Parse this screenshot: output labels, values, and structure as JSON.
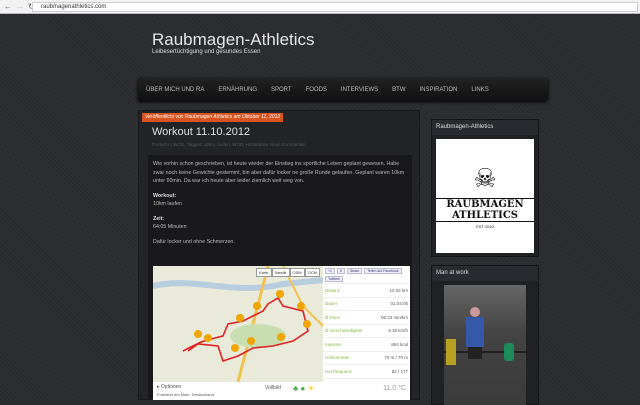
{
  "browser": {
    "url": "raubmagenathletics.com"
  },
  "site": {
    "title": "Raubmagen-Athletics",
    "tagline": "Leibesertüchtigung und gesundes Essen"
  },
  "nav": [
    "ÜBER MICH UND RA",
    "ERNÄHRUNG",
    "SPORT",
    "FOODS",
    "INTERVIEWS",
    "BTW",
    "INSPIRATION",
    "LINKS"
  ],
  "post": {
    "ribbon": "Veröffentlicht von Raubmagen Athletics am Oktober 11, 2012",
    "title": "Workout 11.10.2012",
    "meta": "Posted in: WOD. Tagged: 10km, laufen, WOD. Hinterlasse einen Kommentar",
    "intro": "Wie vorhin schon geschrieben, ist heute wieder der Einstieg ins sportliche Leben geplant gewesen. Habe zwar noch keine Gewichte gestemmt, bin aber dafür locker ne große Runde gelaufen. Geplant waren 10km unter 60min. Da war ich heute aber leider ziemlich weit weg von.",
    "workout_label": "Workout:",
    "workout": "10km laufen",
    "time_label": "Zeit:",
    "time": "64:05 Minuten",
    "outro": "Dafür locker und ohne Schmerzen."
  },
  "map": {
    "tabs": [
      "Karte",
      "Satellit",
      "OSM",
      "OCM"
    ],
    "social": [
      "+1",
      "0",
      "Share",
      "Teilen auf Facebook",
      "Twittern"
    ],
    "stats": [
      {
        "label": "Distanz",
        "value": "10.02 km"
      },
      {
        "label": "Dauer",
        "value": "01:04:05"
      },
      {
        "label": "Ø Pace",
        "value": "06:23 min/km"
      },
      {
        "label": "Ø Geschwindigkeit",
        "value": "9.38 km/h"
      },
      {
        "label": "Kalorien",
        "value": "864 kcal"
      },
      {
        "label": "Höhenmeter",
        "value": "70 m / 70 m"
      },
      {
        "label": "Herzfrequenz",
        "value": "82 / 177"
      }
    ],
    "options": "Optionen",
    "fullscreen": "Vollbild",
    "temperature": "11.0 °C",
    "location": "Frankfurt am Main, Deutschland"
  },
  "sidebar": {
    "widget1": {
      "title": "Raubmagen-Athletics",
      "logo_text": "RAUBMAGEN ATHLETICS",
      "logo_est": "EST 2010"
    },
    "widget2": {
      "title": "Man at work"
    }
  }
}
